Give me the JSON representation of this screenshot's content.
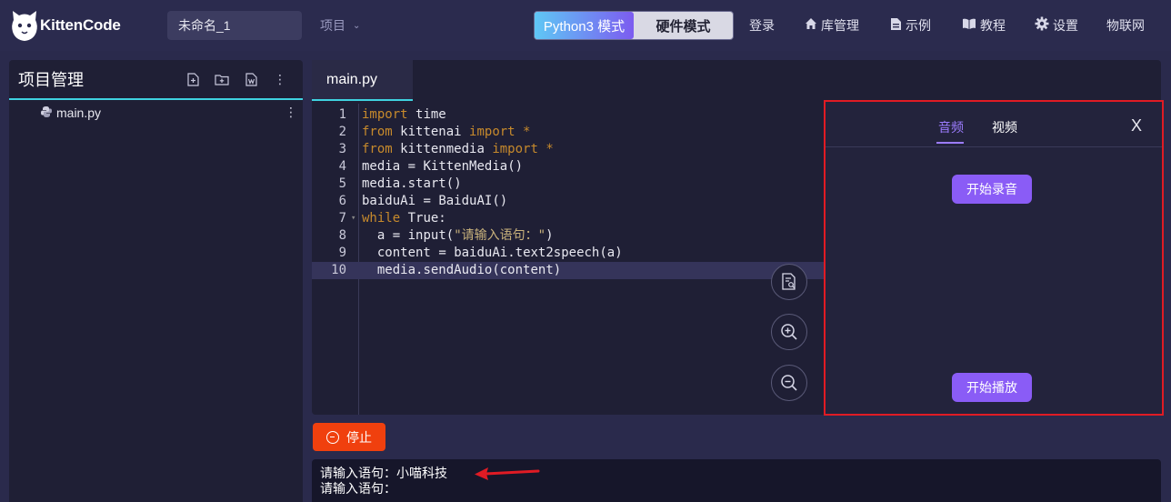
{
  "app": {
    "logo_text": "KittenCode"
  },
  "header": {
    "project_name": "未命名_1",
    "project_menu": "项目",
    "mode_python": "Python3 模式",
    "mode_hardware": "硬件模式",
    "nav": [
      {
        "label": "登录",
        "icon": ""
      },
      {
        "label": "库管理",
        "icon": "home-icon"
      },
      {
        "label": "示例",
        "icon": "document-icon"
      },
      {
        "label": "教程",
        "icon": "book-icon"
      },
      {
        "label": "设置",
        "icon": "gear-icon"
      },
      {
        "label": "物联网",
        "icon": ""
      }
    ]
  },
  "sidebar": {
    "title": "项目管理",
    "files": [
      {
        "name": "main.py"
      }
    ]
  },
  "editor": {
    "tab": "main.py",
    "lines": [
      {
        "n": "1",
        "code": "import time"
      },
      {
        "n": "2",
        "code": "from kittenai import *"
      },
      {
        "n": "3",
        "code": "from kittenmedia import *"
      },
      {
        "n": "4",
        "code": "media = KittenMedia()"
      },
      {
        "n": "5",
        "code": "media.start()"
      },
      {
        "n": "6",
        "code": "baiduAi = BaiduAI()"
      },
      {
        "n": "7",
        "code": "while True:"
      },
      {
        "n": "8",
        "code": "  a = input(\"请输入语句：\")"
      },
      {
        "n": "9",
        "code": "  content = baiduAi.text2speech(a)"
      },
      {
        "n": "10",
        "code": "  media.sendAudio(content)"
      }
    ],
    "highlighted_line": "10"
  },
  "media_panel": {
    "tab_audio": "音频",
    "tab_video": "视频",
    "close": "X",
    "start_record": "开始录音",
    "start_play": "开始播放"
  },
  "run": {
    "stop_label": "停止"
  },
  "console": {
    "lines": [
      "请输入语句：小喵科技",
      "请输入语句："
    ]
  },
  "colors": {
    "accent_cyan": "#3fd2e0",
    "accent_purple": "#8a5cf6",
    "stop_red": "#f0400e",
    "highlight_border": "#e01b24"
  }
}
